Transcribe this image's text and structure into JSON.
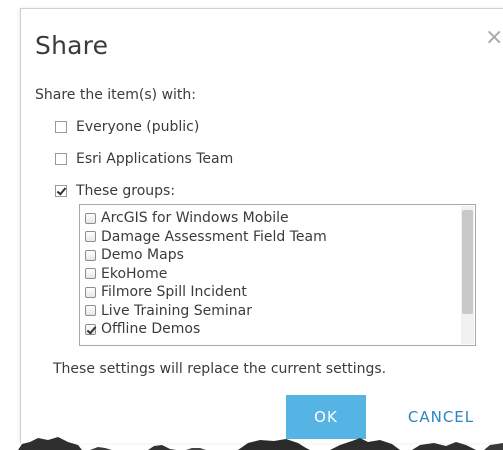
{
  "dialog": {
    "title": "Share",
    "close_glyph": "×"
  },
  "share": {
    "prompt": "Share the item(s) with:",
    "options": [
      {
        "label": "Everyone (public)",
        "checked": false
      },
      {
        "label": "Esri Applications Team",
        "checked": false
      },
      {
        "label": "These groups:",
        "checked": true
      }
    ],
    "groups": [
      {
        "label": "ArcGIS for Windows Mobile",
        "checked": false
      },
      {
        "label": "Damage Assessment Field Team",
        "checked": false
      },
      {
        "label": "Demo Maps",
        "checked": false
      },
      {
        "label": "EkoHome",
        "checked": false
      },
      {
        "label": "Filmore Spill Incident",
        "checked": false
      },
      {
        "label": "Live Training Seminar",
        "checked": false
      },
      {
        "label": "Offline Demos",
        "checked": true
      }
    ],
    "note": "These settings will replace the current settings."
  },
  "buttons": {
    "ok_label": "OK",
    "cancel_label": "CANCEL"
  },
  "colors": {
    "ok_background": "#56b4e4",
    "cancel_text": "#2a86c4"
  }
}
